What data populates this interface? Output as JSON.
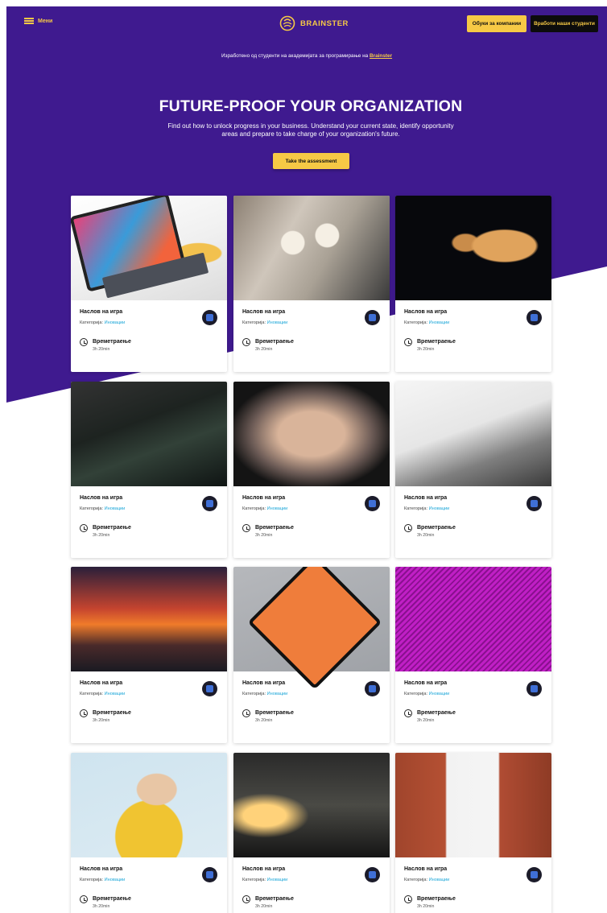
{
  "header": {
    "menu_label": "Мени",
    "brand": "BRAINSTER",
    "btn_trainings": "Обуки за компании",
    "btn_hire": "Вработи наши студенти",
    "note_prefix": "Изработено од студенти на академијата за програмирање на",
    "note_brand": "Brainster"
  },
  "hero": {
    "title": "FUTURE-PROOF YOUR ORGANIZATION",
    "text": "Find out how to unlock progress in your business. Understand your current state, identify opportunity areas and prepare to take charge of your organization's future.",
    "cta": "Take the assessment"
  },
  "colors": {
    "purple": "#3f1a8f",
    "yellow": "#f6c945",
    "link": "#1aa6d8"
  },
  "cards": [
    {
      "title": "Наслов на игра",
      "cat_label": "Категорија:",
      "cat_value": "Иновации",
      "dur_label": "Времетраење",
      "dur_value": "3h 20min",
      "image": "ipad-on-table",
      "badge_icon": "document-icon"
    },
    {
      "title": "Наслов на игра",
      "cat_label": "Категорија:",
      "cat_value": "Иновации",
      "dur_label": "Времетраење",
      "dur_value": "3h 20min",
      "image": "coffee-hands",
      "badge_icon": "phone-icon"
    },
    {
      "title": "Наслов на игра",
      "cat_label": "Категорија:",
      "cat_value": "Иновации",
      "dur_label": "Времетраење",
      "dur_value": "3h 20min",
      "image": "jellyfish",
      "badge_icon": "image-icon"
    },
    {
      "title": "Наслов на игра",
      "cat_label": "Категорија:",
      "cat_value": "Иновации",
      "dur_label": "Времетраење",
      "dur_value": "3h 20min",
      "image": "coastline-aerial",
      "badge_icon": "plane-icon"
    },
    {
      "title": "Наслов на игра",
      "cat_label": "Категорија:",
      "cat_value": "Иновации",
      "dur_label": "Времетраење",
      "dur_value": "3h 20min",
      "image": "airplane-window",
      "badge_icon": "grid-icon"
    },
    {
      "title": "Наслов на игра",
      "cat_label": "Категорија:",
      "cat_value": "Иновации",
      "dur_label": "Времетраење",
      "dur_value": "3h 20min",
      "image": "laptop-watch",
      "badge_icon": "shield-icon"
    },
    {
      "title": "Наслов на игра",
      "cat_label": "Категорија:",
      "cat_value": "Иновации",
      "dur_label": "Времетраење",
      "dur_value": "3h 20min",
      "image": "sunset",
      "badge_icon": "building-icon"
    },
    {
      "title": "Наслов на игра",
      "cat_label": "Категорија:",
      "cat_value": "Иновации",
      "dur_label": "Времетраење",
      "dur_value": "3h 20min",
      "image": "stay-present-sign",
      "badge_icon": "trophy-icon"
    },
    {
      "title": "Наслов на игра",
      "cat_label": "Категорија:",
      "cat_value": "Иновации",
      "dur_label": "Времетраење",
      "dur_value": "3h 20min",
      "image": "magenta-texture",
      "badge_icon": "calendar-icon"
    },
    {
      "title": "Наслов на игра",
      "cat_label": "Категорија:",
      "cat_value": "Иновации",
      "dur_label": "Времетраење",
      "dur_value": "3h 20min",
      "image": "woman-portrait",
      "badge_icon": "send-icon"
    },
    {
      "title": "Наслов на игра",
      "cat_label": "Категорија:",
      "cat_value": "Иновации",
      "dur_label": "Времетраење",
      "dur_value": "3h 20min",
      "image": "city-street",
      "badge_icon": "phone-icon"
    },
    {
      "title": "Наслов на игра",
      "cat_label": "Категорија:",
      "cat_value": "Иновации",
      "dur_label": "Времетраење",
      "dur_value": "3h 20min",
      "image": "bridge-buildings",
      "badge_icon": "image-icon"
    }
  ]
}
